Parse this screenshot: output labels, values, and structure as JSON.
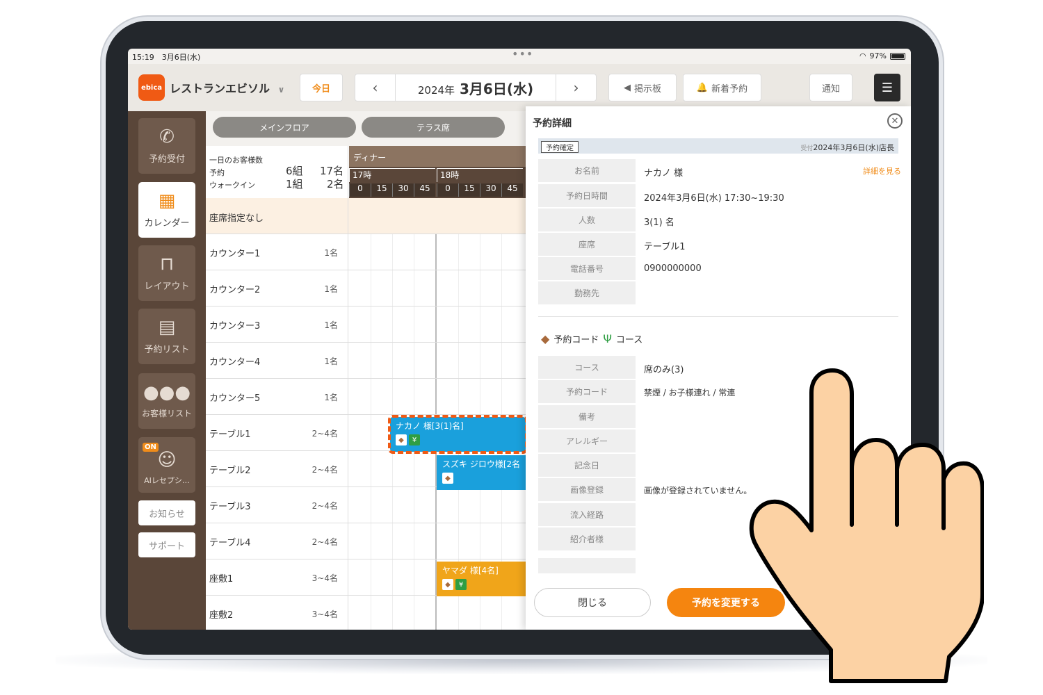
{
  "status": {
    "time": "15:19　3月6日(水)",
    "battery": "97%"
  },
  "header": {
    "logo": "ebica",
    "restaurant": "レストランエビソル",
    "today": "今日",
    "date_year": "2024年",
    "date_main": "3月6日(水)",
    "board": "掲示板",
    "new_reservation": "新着予約",
    "notify": "通知"
  },
  "sidebar": {
    "items": [
      {
        "label": "予約受付"
      },
      {
        "label": "カレンダー"
      },
      {
        "label": "レイアウト"
      },
      {
        "label": "予約リスト"
      },
      {
        "label": "お客様リスト"
      },
      {
        "label": "AIレセプシ…",
        "badge": "ON"
      }
    ],
    "news": "お知らせ",
    "support": "サポート"
  },
  "floors": {
    "main": "メインフロア",
    "terrace": "テラス席"
  },
  "summary": {
    "title": "一日のお客様数",
    "reserve_label": "予約",
    "walkin_label": "ウォークイン",
    "reserve_groups": "6組",
    "walkin_groups": "1組",
    "reserve_people": "17名",
    "walkin_people": "2名"
  },
  "timeline": {
    "service": "ディナー",
    "hours": [
      "17時",
      "18時"
    ],
    "minutes": [
      "0",
      "15",
      "30",
      "45",
      "0",
      "15",
      "30",
      "45"
    ]
  },
  "rows": [
    {
      "name": "座席指定なし",
      "cap": ""
    },
    {
      "name": "カウンター1",
      "cap": "1名"
    },
    {
      "name": "カウンター2",
      "cap": "1名"
    },
    {
      "name": "カウンター3",
      "cap": "1名"
    },
    {
      "name": "カウンター4",
      "cap": "1名"
    },
    {
      "name": "カウンター5",
      "cap": "1名"
    },
    {
      "name": "テーブル1",
      "cap": "2~4名"
    },
    {
      "name": "テーブル2",
      "cap": "2~4名"
    },
    {
      "name": "テーブル3",
      "cap": "2~4名"
    },
    {
      "name": "テーブル4",
      "cap": "2~4名"
    },
    {
      "name": "座敷1",
      "cap": "3~4名"
    },
    {
      "name": "座敷2",
      "cap": "3~4名"
    }
  ],
  "bookings": [
    {
      "label": "ナカノ 様[3(1)名]",
      "color": "#1aa0dc"
    },
    {
      "label": "スズキ ジロウ様[2名]",
      "color": "#1aa0dc"
    },
    {
      "label": "ヤマダ 様[4名]",
      "color": "#f0a51a"
    }
  ],
  "detail": {
    "title": "予約詳細",
    "status": "予約確定",
    "received_prefix": "受付",
    "received": "2024年3月6日(水)店長",
    "more": "詳細を見る",
    "fields": [
      {
        "k": "お名前",
        "v": "ナカノ 様"
      },
      {
        "k": "予約日時間",
        "v": "2024年3月6日(水) 17:30~19:30"
      },
      {
        "k": "人数",
        "v": "3(1) 名"
      },
      {
        "k": "座席",
        "v": "テーブル1"
      },
      {
        "k": "電話番号",
        "v": "0900000000"
      },
      {
        "k": "勤務先",
        "v": ""
      }
    ],
    "section_code": "予約コード",
    "section_course": "コース",
    "fields2": [
      {
        "k": "コース",
        "v": "席のみ(3)"
      },
      {
        "k": "予約コード",
        "v": "禁煙 / お子様連れ / 常連"
      },
      {
        "k": "備考",
        "v": ""
      },
      {
        "k": "アレルギー",
        "v": ""
      },
      {
        "k": "記念日",
        "v": ""
      },
      {
        "k": "画像登録",
        "v": "画像が登録されていません。"
      },
      {
        "k": "流入経路",
        "v": ""
      },
      {
        "k": "紹介者様",
        "v": ""
      }
    ],
    "close": "閉じる",
    "change": "予約を変更する"
  },
  "colors": {
    "accent": "#f5850f",
    "sidebar": "#5a4639",
    "booking_blue": "#1aa0dc",
    "booking_orange": "#f0a51a"
  }
}
